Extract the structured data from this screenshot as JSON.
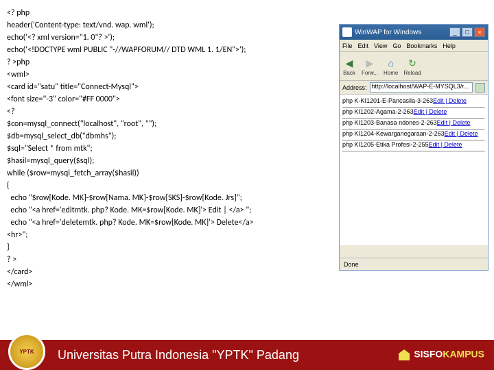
{
  "code": {
    "l1": "<? php",
    "l2": "header('Content-type: text/vnd. wap. wml');",
    "l3": "echo('<? xml version=\"1. 0\"? >');",
    "l4": "echo('<!DOCTYPE wml PUBLIC \"-//WAPFORUM// DTD WML 1. 1/EN\">');",
    "l5": "? >php",
    "l6": "<wml>",
    "l7": "<card id=\"satu\" title=\"Connect-Mysql\">",
    "l8": "<font size=\"-3\" color=\"#FF 0000\">",
    "l9": "<?",
    "l10": "$con=mysql_connect(\"localhost\", \"root\", \"\");",
    "l11": "$db=mysql_select_db(\"dbmhs\");",
    "l12": "$sql=\"Select * from mtk\";",
    "l13": "$hasil=mysql_query($sql);",
    "l14": "while ($row=mysql_fetch_array($hasil))",
    "l15": "{",
    "l16": "  echo \"$row[Kode. MK]-$row[Nama. MK]-$row[SKS]-$row[Kode. Jrs]\";",
    "l17": "  echo \"<a href='editmtk. php? Kode. MK=$row[Kode. MK]'> Edit | </a> \";",
    "l18": "  echo \"<a href='deletemtk. php? Kode. MK=$row[Kode. MK]'> Delete</a>",
    "l19": "<hr>\";",
    "l20": "}",
    "l21": "? >",
    "l22": "</card>",
    "l23": "</wml>"
  },
  "app": {
    "title": "WinWAP for Windows",
    "menu": {
      "file": "File",
      "edit": "Edit",
      "view": "View",
      "go": "Go",
      "bookmarks": "Bookmarks",
      "help": "Help"
    },
    "tools": {
      "back": "Back",
      "fwd": "Forw...",
      "home": "Home",
      "reload": "Reload"
    },
    "addr_label": "Address:",
    "addr_value": "http://localhost/WAP-E-MYSQL3/r...",
    "status": "Done",
    "rows": {
      "r1a": "php K-KI1201-E-Pancasila-3-263",
      "r1b": "Edit | Delete",
      "r2a": "php KI1202-Agama-2-263",
      "r2b": "Edit | Delete",
      "r3a": "php KI1203-Banasa ndones-2-263",
      "r3b": "Edit | Delete",
      "r4a": "php KI1204-Kewarganegaraan-2-263",
      "r4b": "Edit | Delete",
      "r5a": "php KI1205-Etika Profesi-2-255",
      "r5b": "Edit | Delete"
    }
  },
  "footer": {
    "university": "Universitas Putra Indonesia \"YPTK\" Padang",
    "brand1": "SISFO",
    "brand2": "KAMPUS"
  }
}
